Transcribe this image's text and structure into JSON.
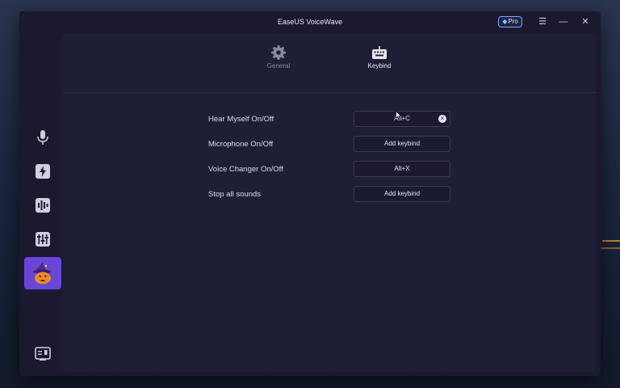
{
  "app": {
    "title": "EaseUS VoiceWave",
    "pro_label": "Pro"
  },
  "window_controls": {
    "menu": "☰",
    "minimize": "—",
    "close": "✕"
  },
  "sidebar": {
    "items": [
      {
        "icon": "microphone-icon"
      },
      {
        "icon": "lightning-icon"
      },
      {
        "icon": "soundboard-icon"
      },
      {
        "icon": "equalizer-icon"
      },
      {
        "icon": "witch-pumpkin-icon",
        "active": true
      },
      {
        "icon": "book-icon"
      }
    ]
  },
  "tabs": [
    {
      "label": "General",
      "icon": "gear-icon",
      "active": false
    },
    {
      "label": "Keybind",
      "icon": "keyboard-icon",
      "active": true
    }
  ],
  "keybinds": [
    {
      "label": "Hear Myself On/Off",
      "value": "Alt+C",
      "clearable": true
    },
    {
      "label": "Microphone On/Off",
      "value": "Add keybind"
    },
    {
      "label": "Voice Changer On/Off",
      "value": "Alt+X"
    },
    {
      "label": "Stop all sounds",
      "value": "Add keybind"
    }
  ],
  "colors": {
    "accent": "#6a46d8",
    "window_bg": "#1a1930",
    "content_bg": "#1f1e37",
    "pro_border": "#7aa8ff"
  }
}
